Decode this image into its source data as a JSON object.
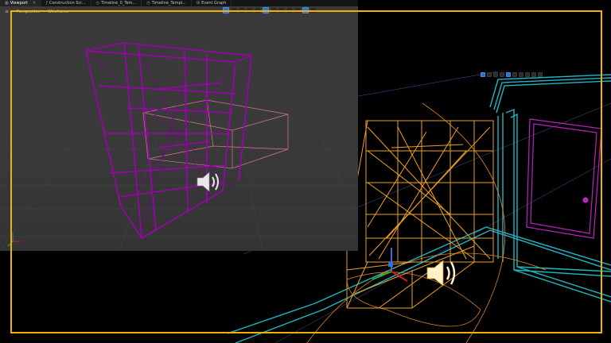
{
  "tabs": [
    {
      "label": "Viewport",
      "icon": "viewport-icon",
      "active": true
    },
    {
      "label": "Construction Scr...",
      "icon": "function-icon",
      "active": false
    },
    {
      "label": "Timeline_0_Tem...",
      "icon": "clock-icon",
      "active": false
    },
    {
      "label": "Timeline_Templ...",
      "icon": "clock-icon",
      "active": false
    },
    {
      "label": "Event Graph",
      "icon": "graph-icon",
      "active": false
    }
  ],
  "viewport_left": {
    "view_mode": "Perspective",
    "render_mode": "Wireframe"
  },
  "colors": {
    "selection_frame": "#f0b400",
    "mesh_left": "#a000b4",
    "mesh_right": "#f0a020",
    "walls": "#1fb6c4",
    "door": "#c020c0"
  }
}
